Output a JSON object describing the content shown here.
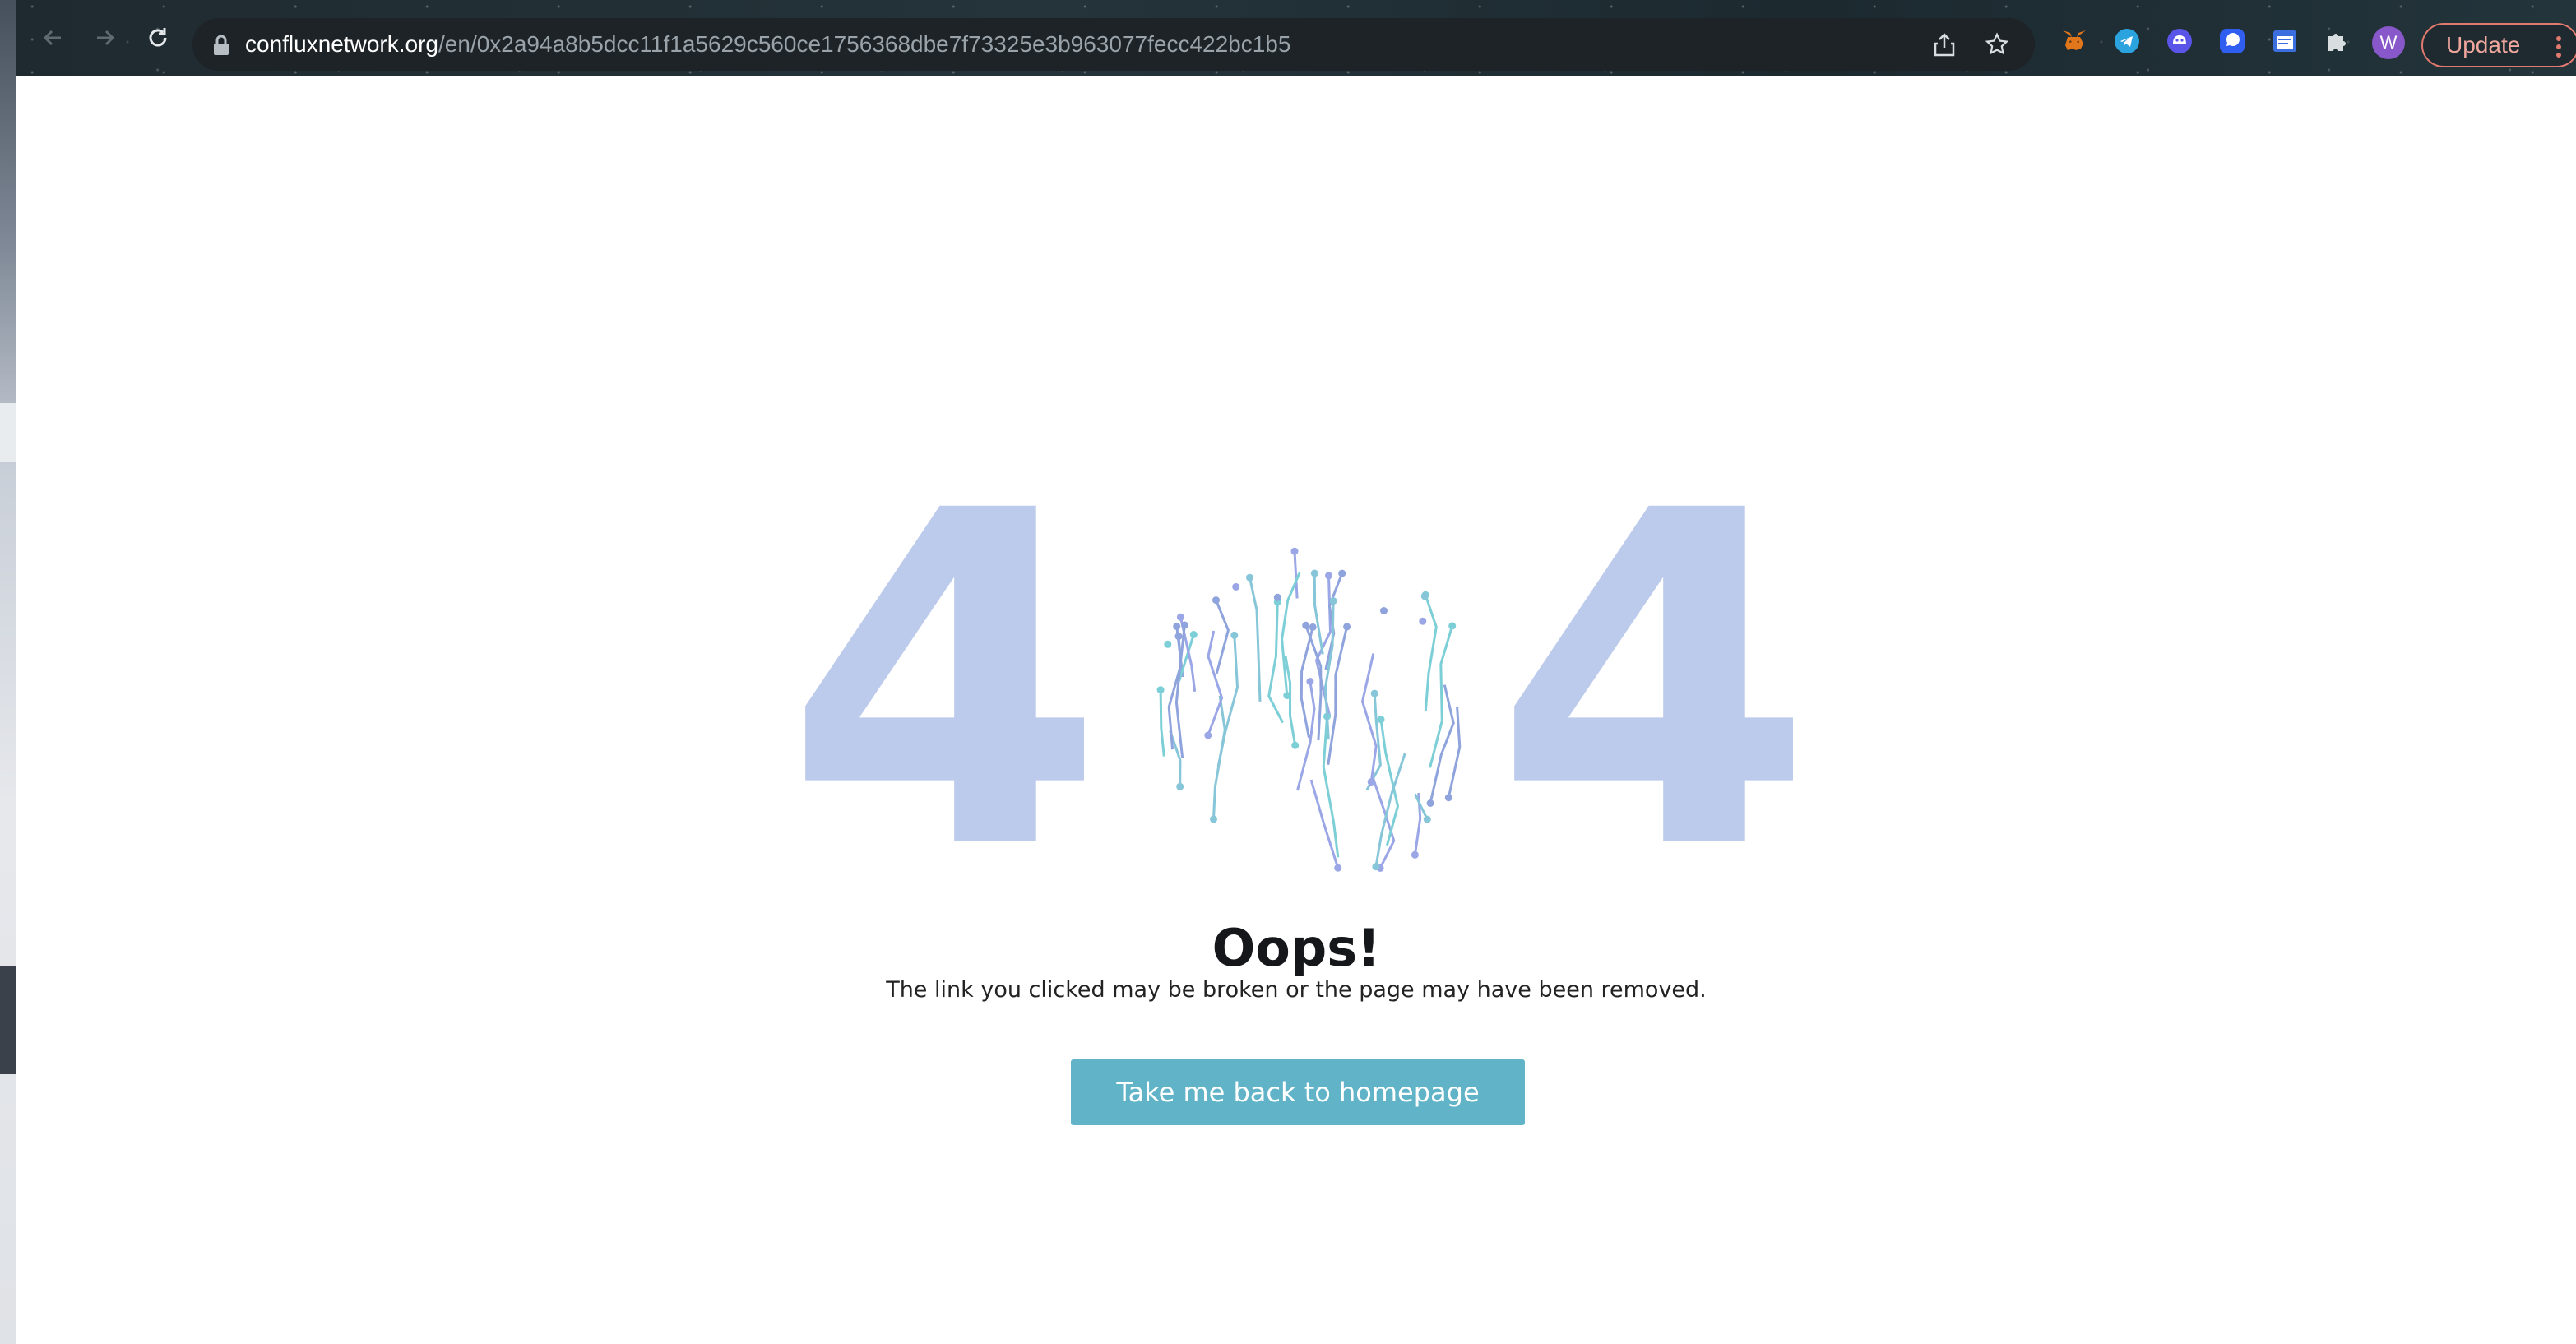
{
  "browser": {
    "url_host": "confluxnetwork.org",
    "url_path": "/en/0x2a94a8b5dcc11f1a5629c560ce1756368dbe7f73325e3b963077fecc422bc1b5",
    "update_label": "Update",
    "avatar_initial": "W",
    "extensions": [
      "metamask-fox-icon",
      "telegram-icon",
      "ghost-icon",
      "chat-bubble-icon",
      "window-icon",
      "puzzle-icon"
    ],
    "accent_color": "#e07a6e"
  },
  "error_page": {
    "digit_left": "4",
    "digit_right": "4",
    "title": "Oops!",
    "message": "The link you clicked may be broken or the page may have been removed.",
    "button_label": "Take me back to homepage",
    "digit_color": "#bccaec",
    "button_color": "#61b4c8"
  }
}
